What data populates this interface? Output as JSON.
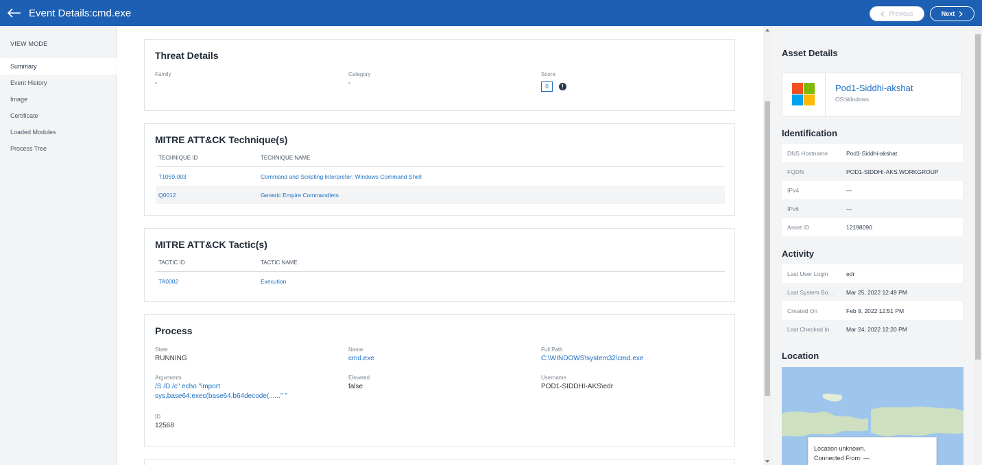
{
  "header": {
    "title": "Event Details:cmd.exe",
    "prev_label": "Previous",
    "next_label": "Next"
  },
  "sidebar": {
    "view_mode": "VIEW MODE",
    "items": [
      {
        "label": "Summary"
      },
      {
        "label": "Event History"
      },
      {
        "label": "Image"
      },
      {
        "label": "Certificate"
      },
      {
        "label": "Loaded Modules"
      },
      {
        "label": "Process Tree"
      }
    ]
  },
  "threat": {
    "title": "Threat Details",
    "family_label": "Family",
    "family_value": "-",
    "category_label": "Category",
    "category_value": "-",
    "score_label": "Score",
    "score_value": "0",
    "info_glyph": "!"
  },
  "techniques": {
    "title": "MITRE ATT&CK Technique(s)",
    "col_id": "TECHNIQUE ID",
    "col_name": "TECHNIQUE NAME",
    "rows": [
      {
        "id": "T1059.003",
        "name": "Command and Scripting Interpreter: Windows Command Shell"
      },
      {
        "id": "Q0012",
        "name": "Generic Empire Commandlets"
      }
    ]
  },
  "tactics": {
    "title": "MITRE ATT&CK Tactic(s)",
    "col_id": "TACTIC ID",
    "col_name": "TACTIC NAME",
    "rows": [
      {
        "id": "TA0002",
        "name": "Execution"
      }
    ]
  },
  "process": {
    "title": "Process",
    "state_label": "State",
    "state_value": "RUNNING",
    "name_label": "Name",
    "name_value": "cmd.exe",
    "fullpath_label": "Full Path",
    "fullpath_value": "C:\\WINDOWS\\system32\\cmd.exe",
    "args_label": "Arguments",
    "args_line1": "/S /D /c\" echo \"import",
    "args_line2": "sys,base64;exec(base64.b64decode(......\" \"",
    "elevated_label": "Elevated",
    "elevated_value": "false",
    "username_label": "Username",
    "username_value": "POD1-SIDDHI-AKS\\edr",
    "id_label": "ID",
    "id_value": "12568"
  },
  "asset": {
    "title": "Asset Details",
    "name": "Pod1-Siddhi-akshat",
    "os": "OS:Windows",
    "logo_colors": [
      "#f25022",
      "#7fba00",
      "#00a4ef",
      "#ffb900"
    ]
  },
  "identification": {
    "title": "Identification",
    "rows": [
      {
        "key": "DNS Hostname",
        "value": "Pod1-Siddhi-akshat"
      },
      {
        "key": "FQDN",
        "value": "POD1-SIDDHI-AKS.WORKGROUP"
      },
      {
        "key": "IPv4",
        "value": "—"
      },
      {
        "key": "IPv6",
        "value": "—"
      },
      {
        "key": "Asset ID",
        "value": "12198090"
      }
    ]
  },
  "activity": {
    "title": "Activity",
    "rows": [
      {
        "key": "Last User Login",
        "value": "edr"
      },
      {
        "key": "Last System Bo...",
        "value": "Mar 25, 2022 12:49 PM"
      },
      {
        "key": "Created On",
        "value": "Feb 9, 2022 12:51 PM"
      },
      {
        "key": "Last Checked In",
        "value": "Mar 24, 2022 12:20 PM"
      }
    ]
  },
  "location": {
    "title": "Location",
    "line1": "Location unknown.",
    "line2": "Connected From: —"
  }
}
